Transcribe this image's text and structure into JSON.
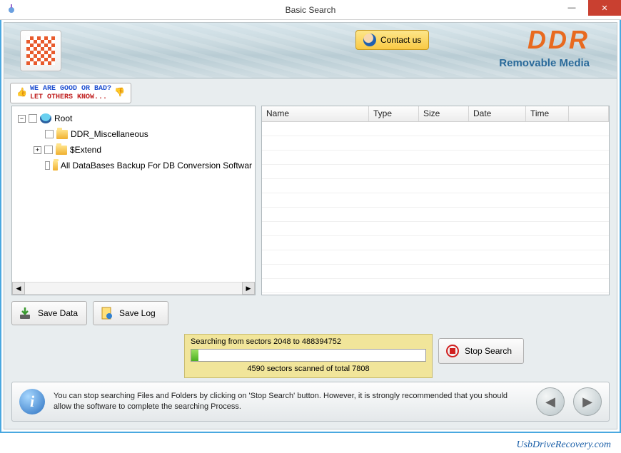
{
  "window": {
    "title": "Basic Search"
  },
  "banner": {
    "contact_label": "Contact us",
    "brand": "DDR",
    "subtitle": "Removable Media"
  },
  "ribbon": {
    "line1": "WE ARE GOOD OR BAD?",
    "line2": "LET OTHERS KNOW..."
  },
  "tree": {
    "root": "Root",
    "items": [
      {
        "label": "DDR_Miscellaneous"
      },
      {
        "label": "$Extend"
      },
      {
        "label": "All DataBases Backup For DB Conversion Softwar"
      }
    ]
  },
  "list": {
    "cols": [
      "Name",
      "Type",
      "Size",
      "Date",
      "Time"
    ]
  },
  "buttons": {
    "save_data": "Save Data",
    "save_log": "Save Log",
    "stop": "Stop Search"
  },
  "progress": {
    "line1": "Searching from sectors 2048 to 488394752",
    "line2": "4590  sectors scanned of total 7808"
  },
  "info": {
    "text": "You can stop searching Files and Folders by clicking on 'Stop Search' button. However, it is strongly recommended that you should allow the software to complete the searching Process."
  },
  "footer": {
    "link": "UsbDriveRecovery.com"
  }
}
